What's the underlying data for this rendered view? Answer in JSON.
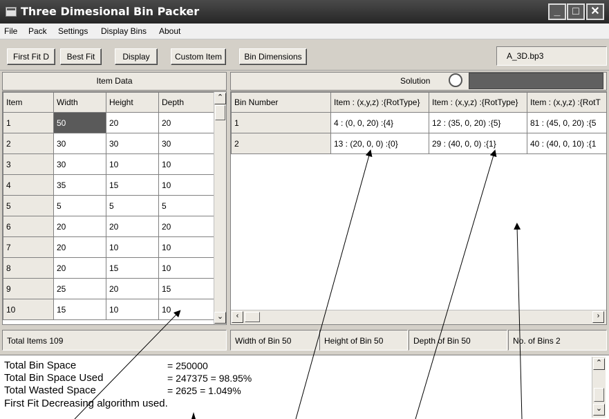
{
  "window": {
    "title": "Three Dimesional Bin Packer"
  },
  "menu": [
    "File",
    "Pack",
    "Settings",
    "Display Bins",
    "About"
  ],
  "toolbar": {
    "first_fit": "First Fit D",
    "best_fit": "Best Fit",
    "display": "Display",
    "custom_item": "Custom Item",
    "bin_dimensions": "Bin Dimensions",
    "filename": "A_3D.bp3"
  },
  "item_data": {
    "header": "Item Data",
    "columns": [
      "Item",
      "Width",
      "Height",
      "Depth"
    ],
    "rows": [
      [
        "1",
        "50",
        "20",
        "20"
      ],
      [
        "2",
        "30",
        "30",
        "30"
      ],
      [
        "3",
        "30",
        "10",
        "10"
      ],
      [
        "4",
        "35",
        "15",
        "10"
      ],
      [
        "5",
        "5",
        "5",
        "5"
      ],
      [
        "6",
        "20",
        "20",
        "20"
      ],
      [
        "7",
        "20",
        "10",
        "10"
      ],
      [
        "8",
        "20",
        "15",
        "10"
      ],
      [
        "9",
        "25",
        "20",
        "15"
      ],
      [
        "10",
        "15",
        "10",
        "10"
      ]
    ],
    "total_items": "Total Items 109"
  },
  "solution": {
    "header": "Solution",
    "progress": 1.0,
    "columns": [
      "Bin Number",
      "Item : (x,y,z) :{RotType}",
      "Item : (x,y,z) :{RotType}",
      "Item : (x,y,z) :{RotT"
    ],
    "rows": [
      [
        "1",
        "4 : (0, 0, 20) :{4}",
        "12 : (35, 0, 20) :{5}",
        "81 : (45, 0, 20) :{5"
      ],
      [
        "2",
        "13 : (20, 0, 0) :{0}",
        "29 : (40, 0, 0) :{1}",
        "40 : (40, 0, 10) :{1"
      ]
    ],
    "width_of_bin": "Width of Bin 50",
    "height_of_bin": "Height of Bin 50",
    "depth_of_bin": "Depth of Bin 50",
    "no_of_bins": "No. of Bins 2"
  },
  "summary": {
    "lines": [
      {
        "label": "Total Bin Space",
        "value": "= 250000"
      },
      {
        "label": "Total Bin Space Used",
        "value": "= 247375 = 98.95%"
      },
      {
        "label": "Total Wasted Space",
        "value": "= 2625 = 1.049%"
      },
      {
        "label": "First Fit Decreasing algorithm used.",
        "value": ""
      }
    ]
  },
  "colors": {
    "accent": "#5a5a5a",
    "panel": "#d4d0c8",
    "titlebar": "#333333"
  }
}
